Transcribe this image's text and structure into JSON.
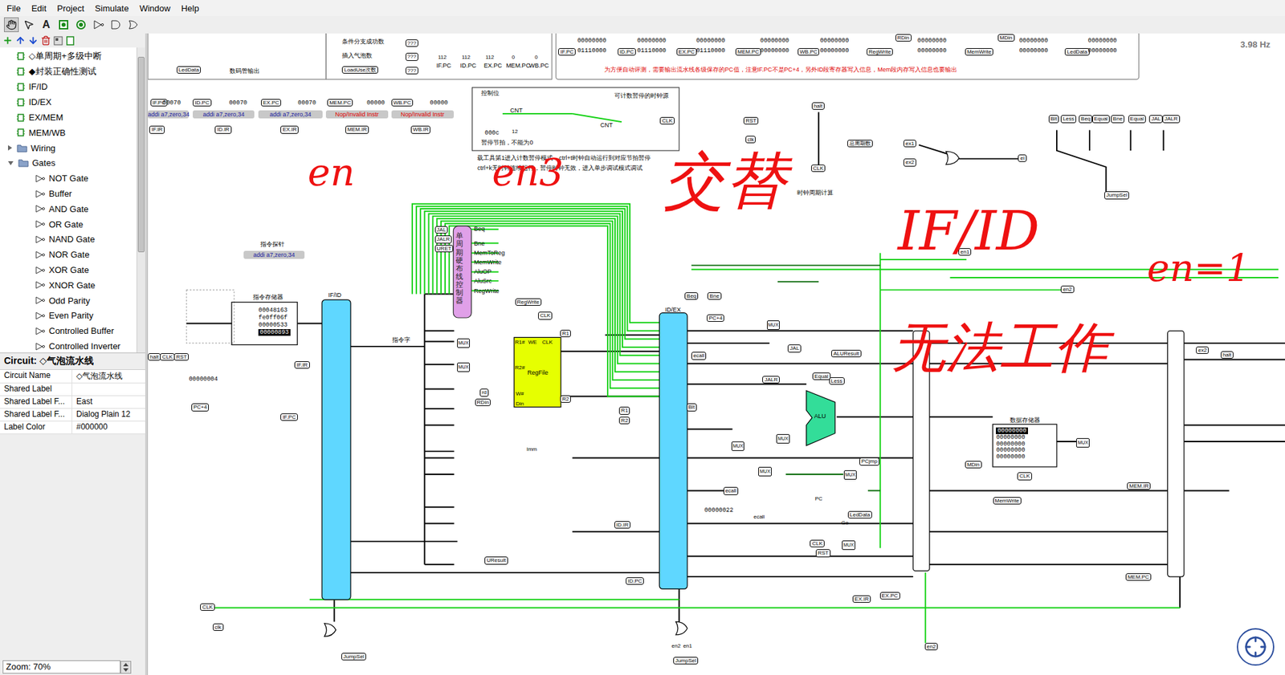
{
  "menu": [
    "File",
    "Edit",
    "Project",
    "Simulate",
    "Window",
    "Help"
  ],
  "toolbar": {
    "text_tool": "A",
    "selected_tool": "hand"
  },
  "explorer": {
    "items": [
      {
        "label": "◇单周期+多级中断",
        "kind": "circuit",
        "depth": 1
      },
      {
        "label": "◆封装正确性测试",
        "kind": "circuit",
        "depth": 1
      },
      {
        "label": "IF/ID",
        "kind": "circuit",
        "depth": 1
      },
      {
        "label": "ID/EX",
        "kind": "circuit",
        "depth": 1
      },
      {
        "label": "EX/MEM",
        "kind": "circuit",
        "depth": 1
      },
      {
        "label": "MEM/WB",
        "kind": "circuit",
        "depth": 1
      },
      {
        "label": "Wiring",
        "kind": "folder",
        "depth": 1,
        "expanded": false
      },
      {
        "label": "Gates",
        "kind": "folder",
        "depth": 1,
        "expanded": true
      },
      {
        "label": "NOT Gate",
        "kind": "gate",
        "depth": 2
      },
      {
        "label": "Buffer",
        "kind": "gate",
        "depth": 2
      },
      {
        "label": "AND Gate",
        "kind": "gate",
        "depth": 2
      },
      {
        "label": "OR Gate",
        "kind": "gate",
        "depth": 2
      },
      {
        "label": "NAND Gate",
        "kind": "gate",
        "depth": 2
      },
      {
        "label": "NOR Gate",
        "kind": "gate",
        "depth": 2
      },
      {
        "label": "XOR Gate",
        "kind": "gate",
        "depth": 2
      },
      {
        "label": "XNOR Gate",
        "kind": "gate",
        "depth": 2
      },
      {
        "label": "Odd Parity",
        "kind": "gate",
        "depth": 2
      },
      {
        "label": "Even Parity",
        "kind": "gate",
        "depth": 2
      },
      {
        "label": "Controlled Buffer",
        "kind": "gate",
        "depth": 2
      },
      {
        "label": "Controlled Inverter",
        "kind": "gate",
        "depth": 2
      }
    ]
  },
  "properties": {
    "title": "Circuit: ◇气泡流水线",
    "rows": [
      {
        "name": "Circuit Name",
        "value": "◇气泡流水线"
      },
      {
        "name": "Shared Label",
        "value": ""
      },
      {
        "name": "Shared Label F...",
        "value": "East"
      },
      {
        "name": "Shared Label F...",
        "value": "Dialog Plain 12"
      },
      {
        "name": "Label Color",
        "value": "#000000"
      }
    ]
  },
  "zoom": "Zoom: 70%",
  "canvas": {
    "items": [
      {
        "text": "LedData",
        "kind": "tunnel"
      },
      {
        "text": "数码管输出",
        "kind": "label"
      },
      {
        "text": "条件分支成功数",
        "kind": "label"
      },
      {
        "text": "???",
        "kind": "tunnel"
      },
      {
        "text": "插入气泡数",
        "kind": "label"
      },
      {
        "text": "???",
        "kind": "tunnel"
      },
      {
        "text": "LoadUse次数",
        "kind": "tunnel"
      },
      {
        "text": "???",
        "kind": "tunnel"
      },
      {
        "text": "112",
        "kind": "small"
      },
      {
        "text": "112",
        "kind": "small"
      },
      {
        "text": "112",
        "kind": "small"
      },
      {
        "text": "0",
        "kind": "small"
      },
      {
        "text": "0",
        "kind": "small"
      },
      {
        "text": "IF.PC",
        "kind": "label"
      },
      {
        "text": "ID.PC",
        "kind": "label"
      },
      {
        "text": "EX.PC",
        "kind": "label"
      },
      {
        "text": "MEM.PC",
        "kind": "label"
      },
      {
        "text": "WB.PC",
        "kind": "label"
      },
      {
        "text": "IF.PC",
        "kind": "tunnel"
      },
      {
        "text": "00000000",
        "kind": "value"
      },
      {
        "text": "01110000",
        "kind": "value"
      },
      {
        "text": "ID.PC",
        "kind": "tunnel"
      },
      {
        "text": "00000000",
        "kind": "value"
      },
      {
        "text": "01110000",
        "kind": "value"
      },
      {
        "text": "EX.PC",
        "kind": "tunnel"
      },
      {
        "text": "00000000",
        "kind": "value"
      },
      {
        "text": "01110000",
        "kind": "value"
      },
      {
        "text": "MEM.PC",
        "kind": "tunnel"
      },
      {
        "text": "00000000",
        "kind": "value"
      },
      {
        "text": "00000000",
        "kind": "value"
      },
      {
        "text": "WB.PC",
        "kind": "tunnel"
      },
      {
        "text": "00000000",
        "kind": "value"
      },
      {
        "text": "00000000",
        "kind": "value"
      },
      {
        "text": "RegWrite",
        "kind": "tunnel"
      },
      {
        "text": "RDin",
        "kind": "tunnel"
      },
      {
        "text": "00000000",
        "kind": "value"
      },
      {
        "text": "00000000",
        "kind": "value"
      },
      {
        "text": "MemWrite",
        "kind": "tunnel"
      },
      {
        "text": "MDin",
        "kind": "tunnel"
      },
      {
        "text": "00000000",
        "kind": "value"
      },
      {
        "text": "00000000",
        "kind": "value"
      },
      {
        "text": "LedData",
        "kind": "tunnel"
      },
      {
        "text": "00000000",
        "kind": "value"
      },
      {
        "text": "00000000",
        "kind": "value"
      },
      {
        "text": "为方便自动评测，需要输出流水线各级保存的PC值，注意IF.PC不是PC+4，另外ID段寄存器写入信息，Mem段内存写入信息也要输出",
        "kind": "note"
      },
      {
        "text": "3.98 Hz",
        "kind": "freq"
      },
      {
        "text": "IF.PC",
        "kind": "tunnel"
      },
      {
        "text": "00070",
        "kind": "value"
      },
      {
        "text": "ID.PC",
        "kind": "tunnel"
      },
      {
        "text": "00070",
        "kind": "value"
      },
      {
        "text": "EX.PC",
        "kind": "tunnel"
      },
      {
        "text": "00070",
        "kind": "value"
      },
      {
        "text": "MEM.PC",
        "kind": "tunnel"
      },
      {
        "text": "00000",
        "kind": "value"
      },
      {
        "text": "WB.PC",
        "kind": "tunnel"
      },
      {
        "text": "00000",
        "kind": "value"
      },
      {
        "text": "addi a7,zero,34",
        "kind": "probe"
      },
      {
        "text": "addi a7,zero,34",
        "kind": "probe"
      },
      {
        "text": "addi a7,zero,34",
        "kind": "probe"
      },
      {
        "text": "Nop/Invalid Instr",
        "kind": "probe-red"
      },
      {
        "text": "Nop/Invalid Instr",
        "kind": "probe-red"
      },
      {
        "text": "IF.IR",
        "kind": "tunnel"
      },
      {
        "text": "ID.IR",
        "kind": "tunnel"
      },
      {
        "text": "EX.IR",
        "kind": "tunnel"
      },
      {
        "text": "MEM.IR",
        "kind": "tunnel"
      },
      {
        "text": "WB.IR",
        "kind": "tunnel"
      },
      {
        "text": "控制位",
        "kind": "label"
      },
      {
        "text": "可计数暂停的时钟源",
        "kind": "label"
      },
      {
        "text": "CNT",
        "kind": "label"
      },
      {
        "text": "CNT",
        "kind": "label"
      },
      {
        "text": "CLK",
        "kind": "tunnel"
      },
      {
        "text": "000c",
        "kind": "value"
      },
      {
        "text": "12",
        "kind": "small"
      },
      {
        "text": "暂停节拍，不能为0",
        "kind": "label"
      },
      {
        "text": "载工具第1进入计数暂停模式，ctrl+t时钟自动运行到对应节拍暂停",
        "kind": "label"
      },
      {
        "text": "ctrl+k无时钟连续运行，暂停时钟无效，进入单步调试模式调试",
        "kind": "label"
      },
      {
        "text": "RST",
        "kind": "tunnel"
      },
      {
        "text": "clk",
        "kind": "tunnel"
      },
      {
        "text": "halt",
        "kind": "tunnel"
      },
      {
        "text": "CLK",
        "kind": "tunnel"
      },
      {
        "text": "总周期数",
        "kind": "tunnel"
      },
      {
        "text": "时钟周期计算",
        "kind": "label"
      },
      {
        "text": "ex1",
        "kind": "tunnel"
      },
      {
        "text": "ex2",
        "kind": "tunnel"
      },
      {
        "text": "ei",
        "kind": "tunnel"
      },
      {
        "text": "Blt",
        "kind": "tunnel"
      },
      {
        "text": "Less",
        "kind": "tunnel"
      },
      {
        "text": "Beq",
        "kind": "tunnel"
      },
      {
        "text": "Equal",
        "kind": "tunnel"
      },
      {
        "text": "Bne",
        "kind": "tunnel"
      },
      {
        "text": "Equal",
        "kind": "tunnel"
      },
      {
        "text": "JAL",
        "kind": "tunnel"
      },
      {
        "text": "JALR",
        "kind": "tunnel"
      },
      {
        "text": "JumpSel",
        "kind": "tunnel"
      },
      {
        "text": "halt",
        "kind": "tunnel"
      },
      {
        "text": "CLK",
        "kind": "tunnel"
      },
      {
        "text": "RST",
        "kind": "tunnel"
      },
      {
        "text": "00000004",
        "kind": "value"
      },
      {
        "text": "PC+4",
        "kind": "tunnel"
      },
      {
        "text": "IF.PC",
        "kind": "tunnel"
      },
      {
        "text": "IF.IR",
        "kind": "tunnel"
      },
      {
        "text": "指令存储器",
        "kind": "label"
      },
      {
        "text": "指令探针",
        "kind": "label"
      },
      {
        "text": "addi a7,zero,34",
        "kind": "probe"
      },
      {
        "text": "00048163",
        "kind": "memrow"
      },
      {
        "text": "fe0ff06f",
        "kind": "memrow"
      },
      {
        "text": "00000533",
        "kind": "memrow"
      },
      {
        "text": "00000893",
        "kind": "memsel"
      },
      {
        "text": "IF/ID",
        "kind": "label"
      },
      {
        "text": "ID/EX",
        "kind": "label"
      },
      {
        "text": "指令字",
        "kind": "label"
      },
      {
        "text": "JAL",
        "kind": "tunnel"
      },
      {
        "text": "JALR",
        "kind": "tunnel"
      },
      {
        "text": "URET",
        "kind": "tunnel"
      },
      {
        "text": "Beq",
        "kind": "label"
      },
      {
        "text": "Bne",
        "kind": "label"
      },
      {
        "text": "MemToReg",
        "kind": "label"
      },
      {
        "text": "MemWrite",
        "kind": "label"
      },
      {
        "text": "AluOP",
        "kind": "label"
      },
      {
        "text": "AluSrc",
        "kind": "label"
      },
      {
        "text": "RegWrite",
        "kind": "label"
      },
      {
        "text": "单周期硬布线控制器",
        "kind": "vertical"
      },
      {
        "text": "RegWrite",
        "kind": "tunnel"
      },
      {
        "text": "CLK",
        "kind": "tunnel"
      },
      {
        "text": "R1",
        "kind": "tunnel"
      },
      {
        "text": "R2",
        "kind": "tunnel"
      },
      {
        "text": "R1#",
        "kind": "small"
      },
      {
        "text": "WE",
        "kind": "small"
      },
      {
        "text": "CLK",
        "kind": "small"
      },
      {
        "text": "R2#",
        "kind": "small"
      },
      {
        "text": "RegFile",
        "kind": "label"
      },
      {
        "text": "W#",
        "kind": "small"
      },
      {
        "text": "Din",
        "kind": "small"
      },
      {
        "text": "rd",
        "kind": "tunnel"
      },
      {
        "text": "RDin",
        "kind": "tunnel"
      },
      {
        "text": "Imm",
        "kind": "small"
      },
      {
        "text": "ID.IR",
        "kind": "tunnel"
      },
      {
        "text": "UResult",
        "kind": "tunnel"
      },
      {
        "text": "ID.PC",
        "kind": "tunnel"
      },
      {
        "text": "Beq",
        "kind": "tunnel"
      },
      {
        "text": "Bne",
        "kind": "tunnel"
      },
      {
        "text": "PC+4",
        "kind": "tunnel"
      },
      {
        "text": "ecall",
        "kind": "tunnel"
      },
      {
        "text": "JAL",
        "kind": "tunnel"
      },
      {
        "text": "JALR",
        "kind": "tunnel"
      },
      {
        "text": "ALUResult",
        "kind": "tunnel"
      },
      {
        "text": "Equal",
        "kind": "tunnel"
      },
      {
        "text": "Less",
        "kind": "tunnel"
      },
      {
        "text": "ALU",
        "kind": "label"
      },
      {
        "text": "R1",
        "kind": "tunnel"
      },
      {
        "text": "R2",
        "kind": "tunnel"
      },
      {
        "text": "Blt",
        "kind": "tunnel"
      },
      {
        "text": "PCjmp",
        "kind": "tunnel"
      },
      {
        "text": "PC",
        "kind": "small"
      },
      {
        "text": "LedData",
        "kind": "tunnel"
      },
      {
        "text": "Go",
        "kind": "small"
      },
      {
        "text": "CLK",
        "kind": "tunnel"
      },
      {
        "text": "RST",
        "kind": "tunnel"
      },
      {
        "text": "ecall",
        "kind": "tunnel"
      },
      {
        "text": "ecall",
        "kind": "small"
      },
      {
        "text": "00000022",
        "kind": "value"
      },
      {
        "text": "EX.IR",
        "kind": "tunnel"
      },
      {
        "text": "EX.PC",
        "kind": "tunnel"
      },
      {
        "text": "en1",
        "kind": "tunnel"
      },
      {
        "text": "en2",
        "kind": "tunnel"
      },
      {
        "text": "ex2",
        "kind": "tunnel"
      },
      {
        "text": "halt",
        "kind": "tunnel"
      },
      {
        "text": "数据存储器",
        "kind": "label"
      },
      {
        "text": "00000000",
        "kind": "memsel"
      },
      {
        "text": "00000000",
        "kind": "memrow"
      },
      {
        "text": "00000000",
        "kind": "memrow"
      },
      {
        "text": "00000000",
        "kind": "memrow"
      },
      {
        "text": "00000000",
        "kind": "memrow"
      },
      {
        "text": "MDin",
        "kind": "tunnel"
      },
      {
        "text": "CLK",
        "kind": "tunnel"
      },
      {
        "text": "MemWrite",
        "kind": "tunnel"
      },
      {
        "text": "MEM.IR",
        "kind": "tunnel"
      },
      {
        "text": "MEM.PC",
        "kind": "tunnel"
      },
      {
        "text": "en2",
        "kind": "tunnel"
      },
      {
        "text": "CLK",
        "kind": "tunnel"
      },
      {
        "text": "clk",
        "kind": "tunnel"
      },
      {
        "text": "JumpSel",
        "kind": "tunnel"
      },
      {
        "text": "en2",
        "kind": "small"
      },
      {
        "text": "en1",
        "kind": "small"
      },
      {
        "text": "JumpSel",
        "kind": "tunnel"
      },
      {
        "text": "MUX",
        "kind": "mux"
      },
      {
        "text": "MUX",
        "kind": "mux"
      },
      {
        "text": "MUX",
        "kind": "mux"
      },
      {
        "text": "MUX",
        "kind": "mux"
      },
      {
        "text": "MUX",
        "kind": "mux"
      },
      {
        "text": "MUX",
        "kind": "mux"
      },
      {
        "text": "MUX",
        "kind": "mux"
      },
      {
        "text": "MUX",
        "kind": "mux"
      },
      {
        "text": "MUX",
        "kind": "mux"
      }
    ]
  },
  "annotations": [
    {
      "text": "en"
    },
    {
      "text": "en3"
    },
    {
      "text": "交替"
    },
    {
      "text": "IF/ID"
    },
    {
      "text": "en=1"
    },
    {
      "text": "无法工作"
    }
  ]
}
